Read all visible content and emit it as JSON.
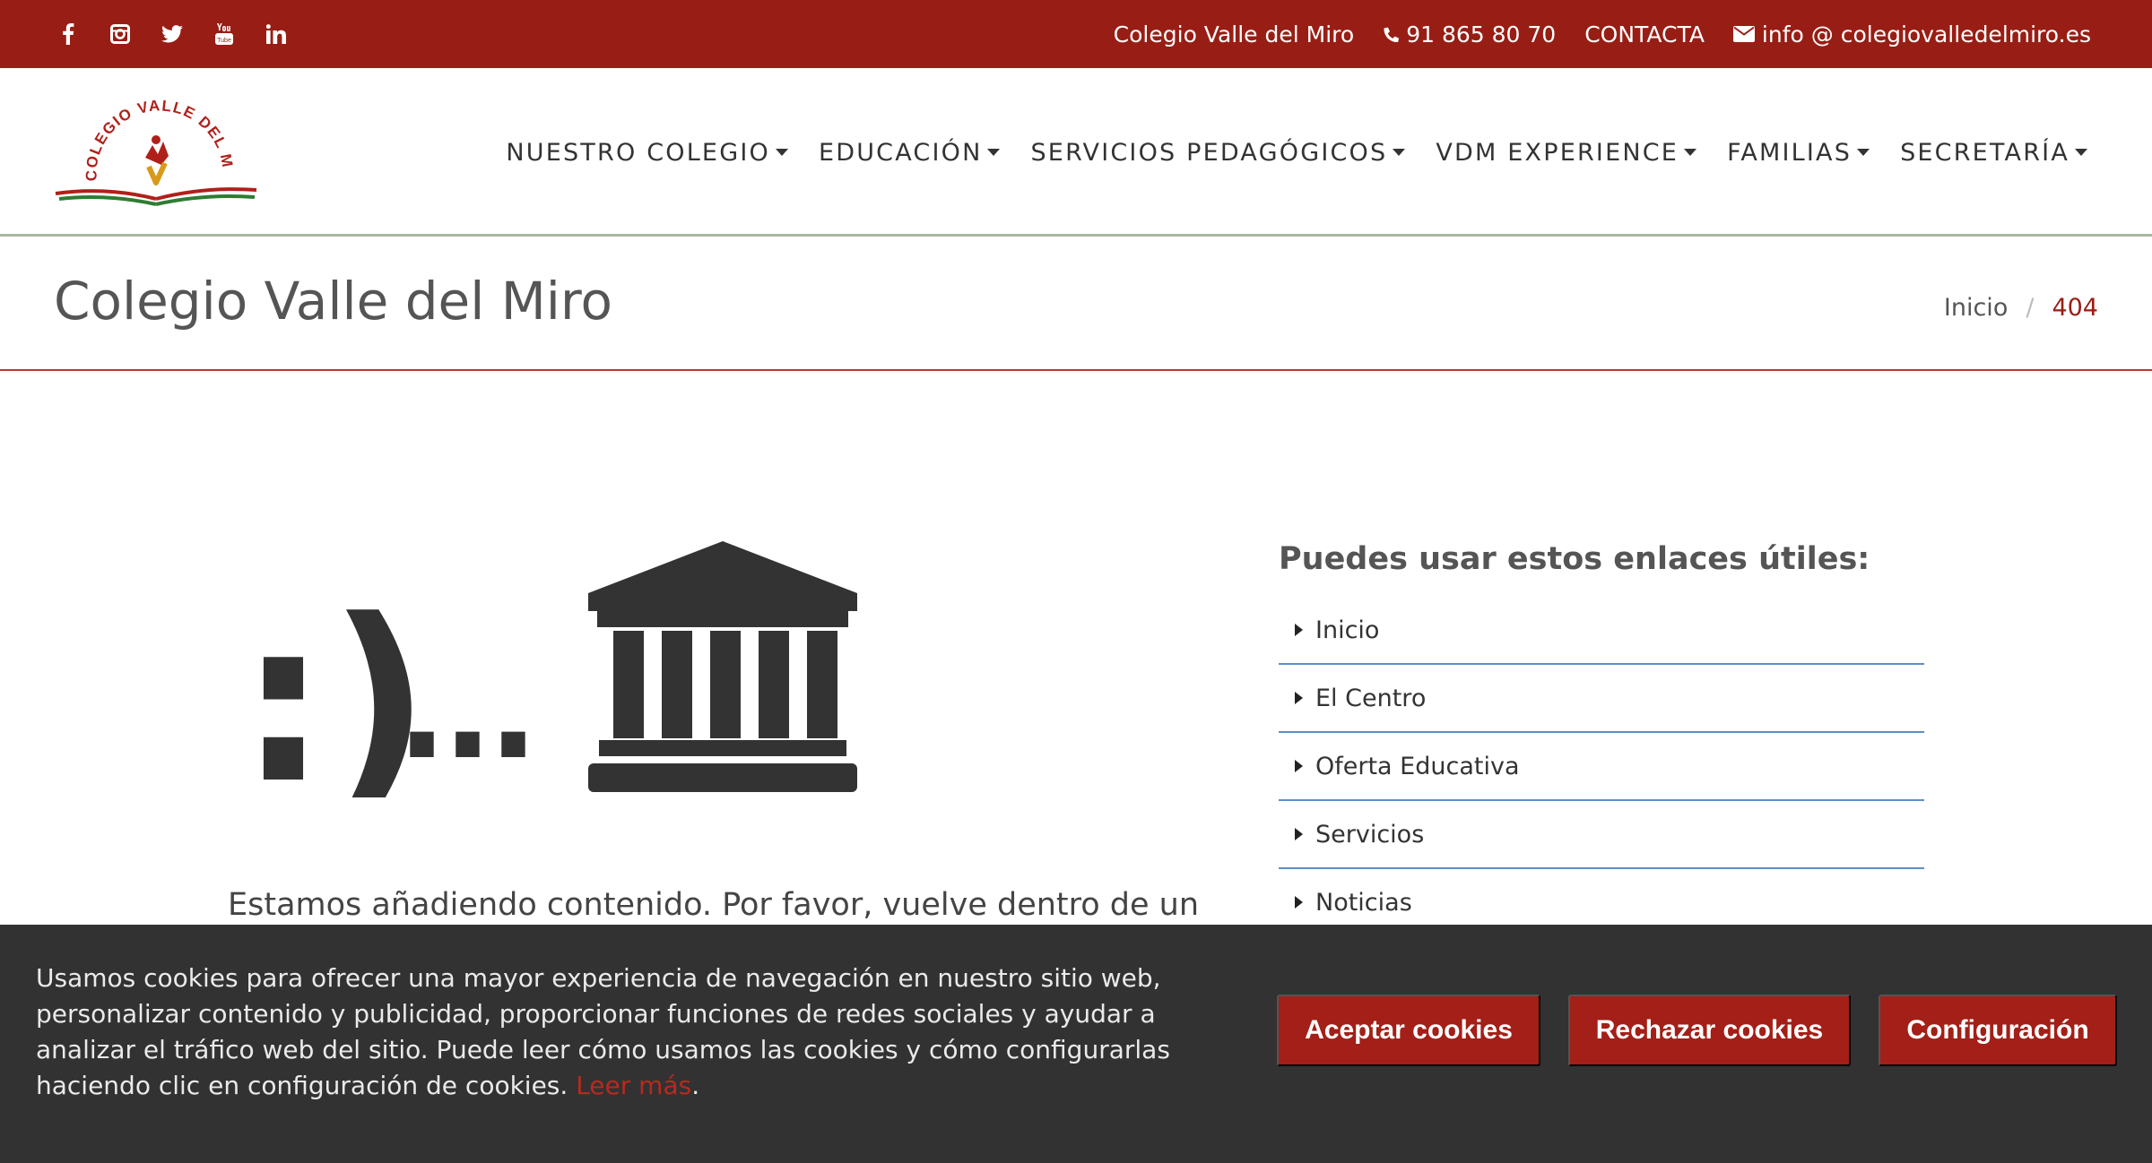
{
  "topbar": {
    "social": [
      {
        "icon": "facebook-icon"
      },
      {
        "icon": "instagram-icon"
      },
      {
        "icon": "twitter-icon"
      },
      {
        "icon": "youtube-icon"
      },
      {
        "icon": "linkedin-icon"
      }
    ],
    "school_name": "Colegio Valle del Miro",
    "phone": "91 865 80 70",
    "contact": "CONTACTA",
    "email": "info @ colegiovalledelmiro.es"
  },
  "logo": {
    "text": "COLEGIO VALLE DEL MIRO"
  },
  "nav": {
    "items": [
      {
        "label": "NUESTRO COLEGIO"
      },
      {
        "label": "EDUCACIÓN"
      },
      {
        "label": "SERVICIOS PEDAGÓGICOS"
      },
      {
        "label": "VDM EXPERIENCE"
      },
      {
        "label": "FAMILIAS"
      },
      {
        "label": "SECRETARÍA"
      }
    ]
  },
  "page": {
    "title": "Colegio Valle del Miro",
    "breadcrumb_home": "Inicio",
    "breadcrumb_sep": "/",
    "breadcrumb_current": "404"
  },
  "main": {
    "smiley": ":)",
    "dots": "...",
    "message": "Estamos añadiendo contenido. Por favor, vuelve dentro de un"
  },
  "links": {
    "title": "Puedes usar estos enlaces útiles:",
    "items": [
      {
        "label": "Inicio"
      },
      {
        "label": "El Centro"
      },
      {
        "label": "Oferta Educativa"
      },
      {
        "label": "Servicios"
      },
      {
        "label": "Noticias"
      }
    ]
  },
  "cookies": {
    "text": "Usamos cookies para ofrecer una mayor experiencia de navegación en nuestro sitio web, personalizar contenido y publicidad, proporcionar funciones de redes sociales y ayudar a analizar el tráfico web del sitio. Puede leer cómo usamos las cookies y cómo configurarlas haciendo clic en configuración de cookies.",
    "more": "Leer más",
    "period": ".",
    "accept": "Aceptar cookies",
    "reject": "Rechazar cookies",
    "config": "Configuración"
  },
  "colors": {
    "brand_red": "#981e15",
    "link_border": "#5b8fc7",
    "cookie_bg": "#323232"
  }
}
